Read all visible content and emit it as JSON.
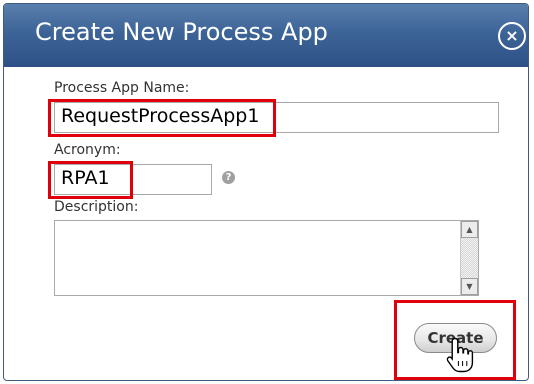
{
  "dialog": {
    "title": "Create New Process App",
    "close_label": "×"
  },
  "form": {
    "name_label": "Process App Name:",
    "name_value": "RequestProcessApp1",
    "acronym_label": "Acronym:",
    "acronym_value": "RPA1",
    "help_label": "?",
    "description_label": "Description:",
    "description_value": ""
  },
  "scrollbar": {
    "up_arrow": "▲",
    "down_arrow": "▼"
  },
  "actions": {
    "create_label": "Create"
  },
  "colors": {
    "titlebar": "#3d6497",
    "highlight": "#e0000b"
  },
  "icons": {
    "close": "close-icon",
    "help": "help-icon",
    "cursor": "hand-pointer-cursor"
  }
}
